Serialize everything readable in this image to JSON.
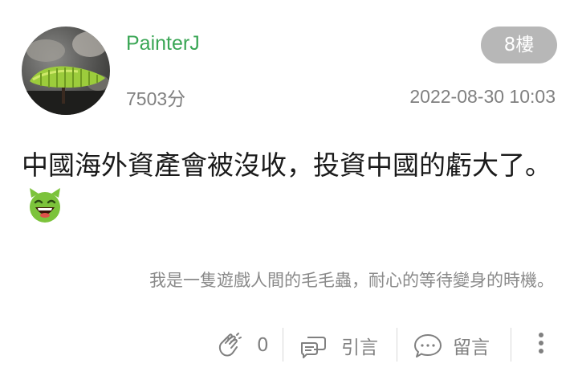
{
  "post": {
    "username": "PainterJ",
    "score": "7503分",
    "floor": "8樓",
    "timestamp": "2022-08-30 10:03",
    "content": "中國海外資產會被沒收，投資中國的虧大了。",
    "emoji_icon": "grinning-devil-emoji",
    "signature": "我是一隻遊戲人間的毛毛蟲，耐心的等待變身的時機。"
  },
  "actions": {
    "like_count": "0",
    "quote_label": "引言",
    "comment_label": "留言"
  },
  "colors": {
    "username": "#3aa655",
    "badge_bg": "#b7b7b7",
    "meta_text": "#808080",
    "emoji": "#7cc33b"
  }
}
